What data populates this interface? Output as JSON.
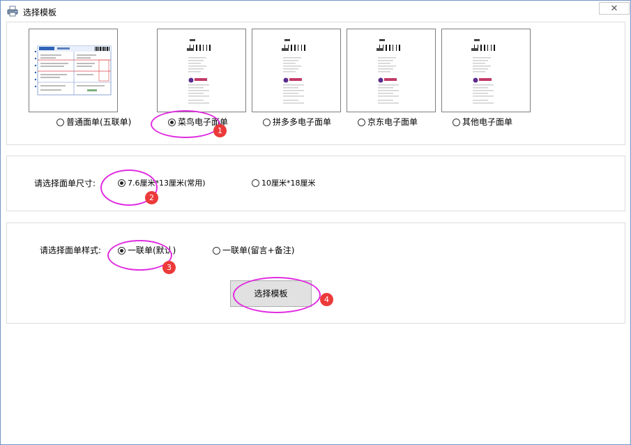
{
  "window": {
    "title": "选择模板",
    "close_glyph": "✕",
    "icon": "printer-icon"
  },
  "templates": {
    "options": [
      {
        "label": "普通面单(五联单)",
        "checked": false,
        "preview": "five-copy-waybill"
      },
      {
        "label": "菜鸟电子面单",
        "checked": true,
        "preview": "electronic-waybill"
      },
      {
        "label": "拼多多电子面单",
        "checked": false,
        "preview": "electronic-waybill"
      },
      {
        "label": "京东电子面单",
        "checked": false,
        "preview": "electronic-waybill"
      },
      {
        "label": "其他电子面单",
        "checked": false,
        "preview": "electronic-waybill"
      }
    ]
  },
  "size": {
    "label": "请选择面单尺寸:",
    "options": [
      {
        "label": "7.6厘米*13厘米(常用)",
        "checked": true
      },
      {
        "label": "10厘米*18厘米",
        "checked": false
      }
    ]
  },
  "style": {
    "label": "请选择面单样式:",
    "options": [
      {
        "label": "一联单(默认)",
        "checked": true
      },
      {
        "label": "一联单(留言+备注)",
        "checked": false
      }
    ]
  },
  "button": {
    "label": "选择模板"
  },
  "annotations": {
    "accent": "#e02ce0",
    "badge_color": "#ec3a3a",
    "badges": [
      "1",
      "2",
      "3",
      "4"
    ]
  }
}
